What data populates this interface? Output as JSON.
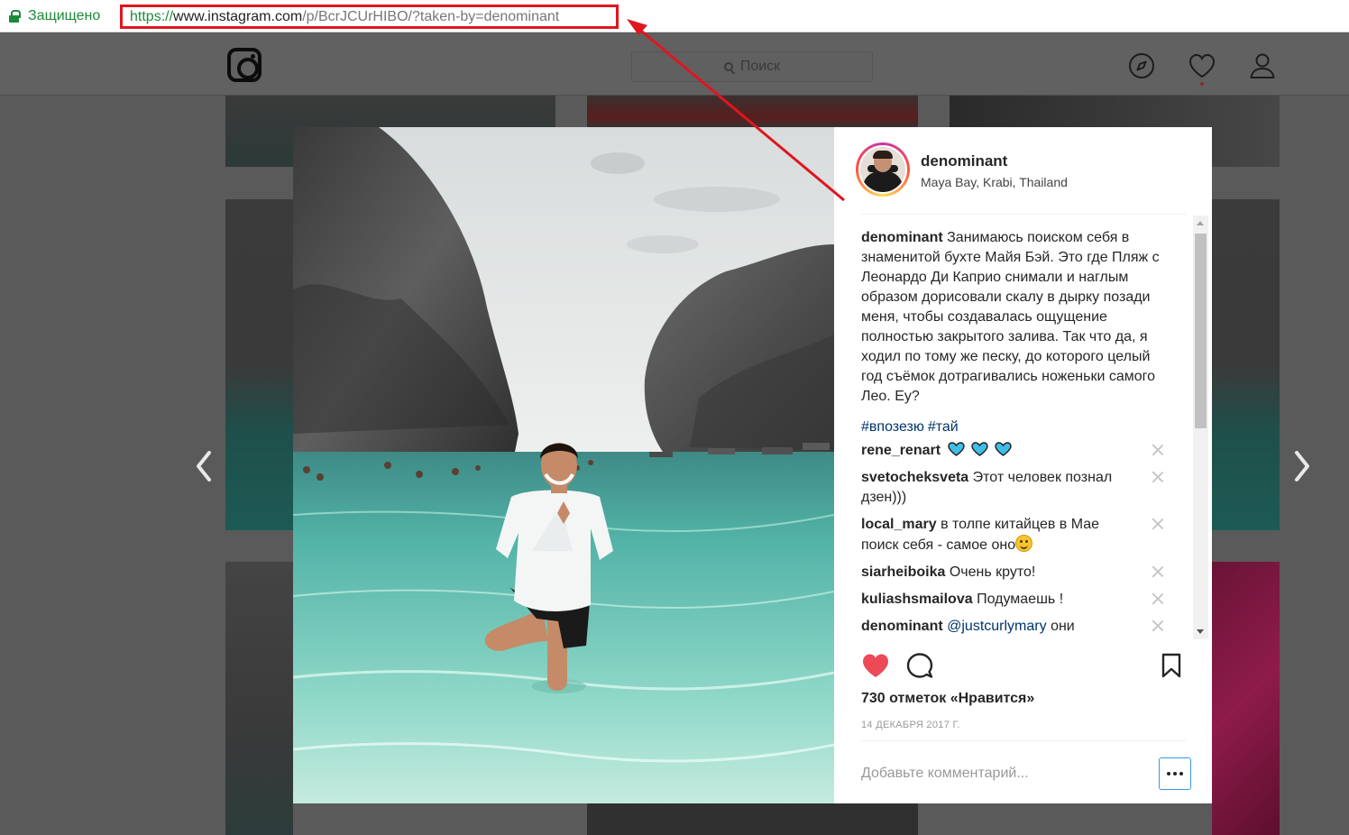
{
  "browser": {
    "secure_label": "Защищено",
    "url_protocol": "https://",
    "url_host": "www.instagram.com",
    "url_path": "/p/BcrJCUrHIBO/?taken-by=denominant",
    "accent_secure": "#1d8a3a",
    "highlight_color": "#e0161e"
  },
  "header": {
    "logo": "instagram-logo-icon",
    "search_placeholder": "Поиск",
    "icons": [
      "explore-compass-icon",
      "activity-heart-icon",
      "profile-person-icon"
    ]
  },
  "post": {
    "username": "denominant",
    "location": "Maya Bay, Krabi, Thailand",
    "caption_user": "denominant",
    "caption_text": "Занимаюсь поиском себя в знаменитой бухте Майя Бэй. Это где Пляж с Леонардо Ди Каприо снимали и наглым образом дорисовали скалу в дырку позади меня, чтобы создавалась ощущение полностью закрытого залива. Так что да, я ходил по тому же песку, до которого целый год съёмок дотрагивались ноженьки самого Лео. Еу?",
    "hashtags": [
      "#впозезю",
      "#тай"
    ],
    "comments": [
      {
        "user": "rene_renart",
        "text": ""
      },
      {
        "user": "svetocheksveta",
        "text": "Этот человек познал дзен)))"
      },
      {
        "user": "local_mary",
        "text": "в толпе китайцев в Мае поиск себя - самое оно"
      },
      {
        "user": "siarheiboika",
        "text": "Очень круто!"
      },
      {
        "user": "kuliashsmailova",
        "text": "Подумаешь !"
      },
      {
        "user": "denominant",
        "mention": "@justcurlymary",
        "text": "они"
      }
    ],
    "likes_text": "730 отметок «Нравится»",
    "date": "14 ДЕКАБРЯ 2017 Г.",
    "add_comment_placeholder": "Добавьте комментарий...",
    "liked_color": "#ed4956"
  }
}
